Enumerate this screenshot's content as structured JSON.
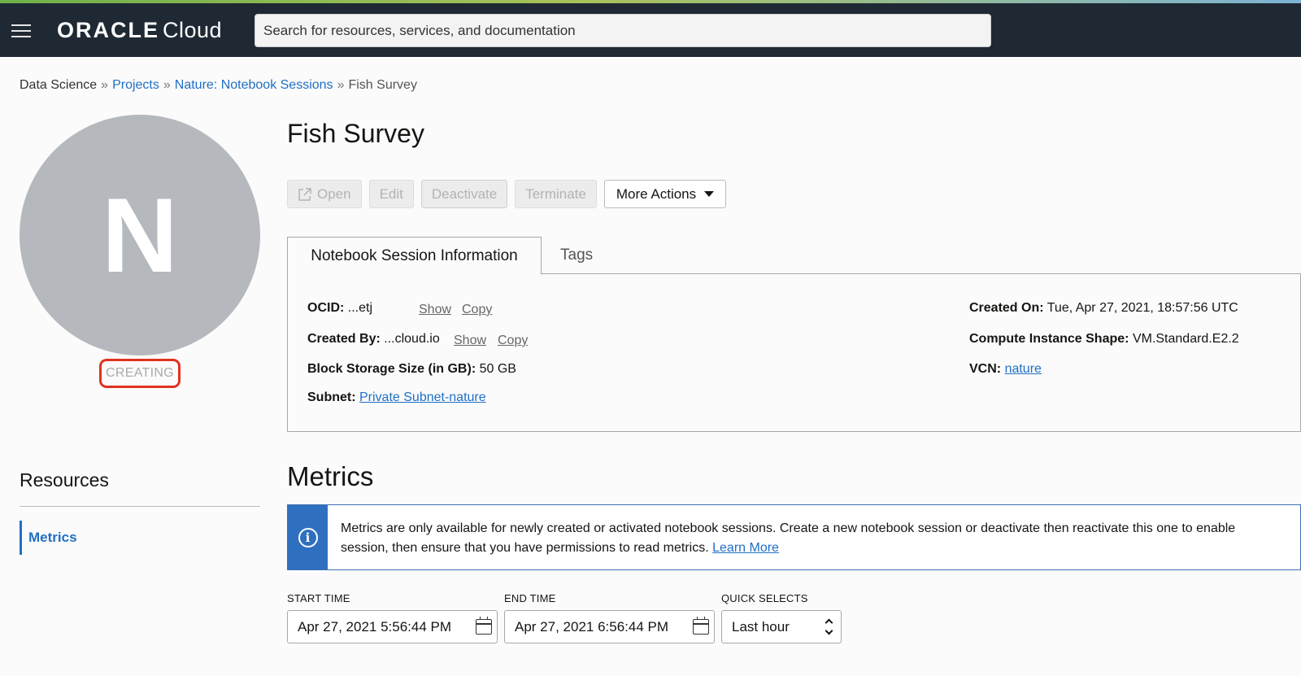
{
  "header": {
    "brand": "ORACLE",
    "product": "Cloud",
    "search_placeholder": "Search for resources, services, and documentation"
  },
  "breadcrumb": {
    "root": "Data Science",
    "projects": "Projects",
    "project": "Nature: Notebook Sessions",
    "current": "Fish Survey",
    "separator": "»"
  },
  "session": {
    "avatar_letter": "N",
    "status": "CREATING",
    "title": "Fish Survey"
  },
  "actions": {
    "open": "Open",
    "edit": "Edit",
    "deactivate": "Deactivate",
    "terminate": "Terminate",
    "more": "More Actions"
  },
  "tabs": {
    "info": "Notebook Session Information",
    "tags": "Tags"
  },
  "info": {
    "ocid_label": "OCID:",
    "ocid_value": "...etj",
    "show": "Show",
    "copy": "Copy",
    "created_by_label": "Created By:",
    "created_by_value": "...cloud.io",
    "block_storage_label": "Block Storage Size (in GB):",
    "block_storage_value": "50 GB",
    "subnet_label": "Subnet:",
    "subnet_value": "Private Subnet-nature",
    "created_on_label": "Created On:",
    "created_on_value": "Tue, Apr 27, 2021, 18:57:56 UTC",
    "shape_label": "Compute Instance Shape:",
    "shape_value": "VM.Standard.E2.2",
    "vcn_label": "VCN:",
    "vcn_value": "nature"
  },
  "resources": {
    "title": "Resources",
    "items": [
      {
        "label": "Metrics"
      }
    ]
  },
  "metrics": {
    "title": "Metrics",
    "alert_line1": "Metrics are only available for newly created or activated notebook sessions. Create a new notebook session or deactivate then reactivate this one to enable",
    "alert_line2": "session, then ensure that you have permissions to read metrics.",
    "learn_more": "Learn More",
    "start_label": "START TIME",
    "start_value": "Apr 27, 2021 5:56:44 PM",
    "end_label": "END TIME",
    "end_value": "Apr 27, 2021 6:56:44 PM",
    "quick_label": "QUICK SELECTS",
    "quick_value": "Last hour"
  }
}
